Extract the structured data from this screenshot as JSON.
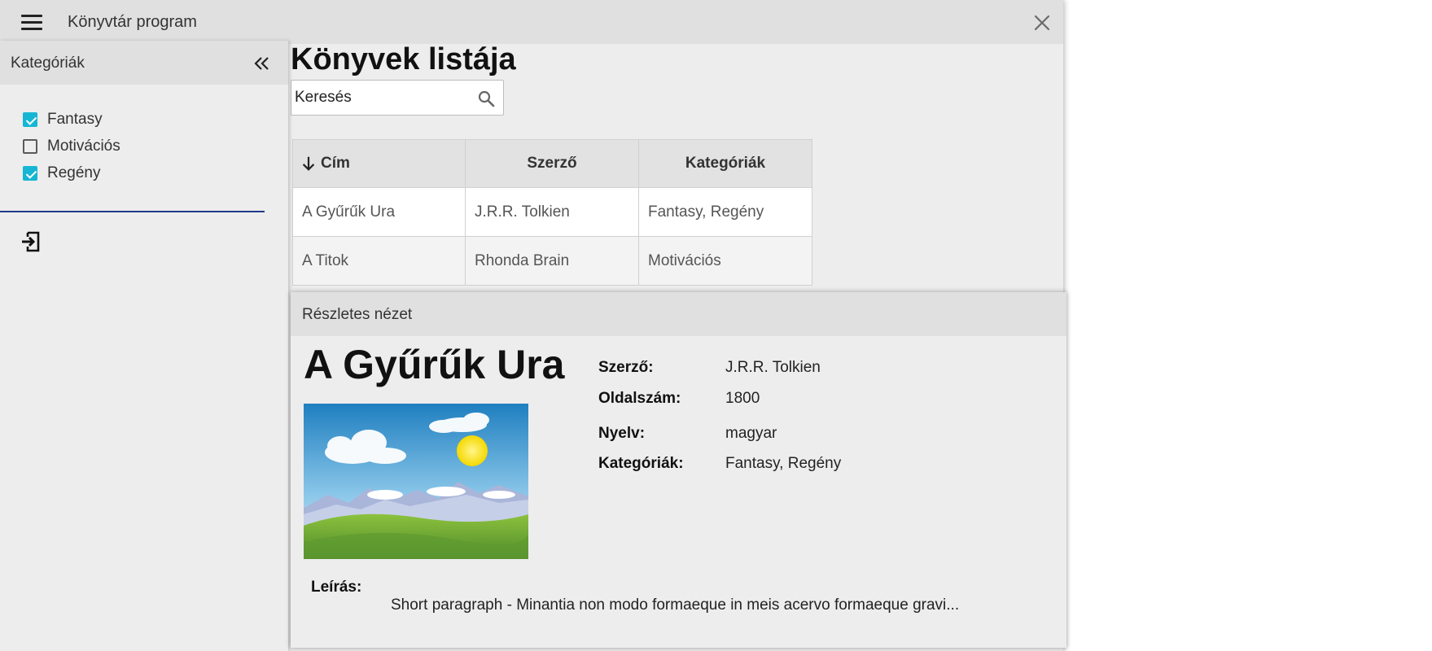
{
  "app": {
    "title": "Könyvtár program"
  },
  "sidebar": {
    "title": "Kategóriák",
    "categories": [
      {
        "label": "Fantasy",
        "checked": true
      },
      {
        "label": "Motivációs",
        "checked": false
      },
      {
        "label": "Regény",
        "checked": true
      }
    ]
  },
  "main": {
    "title": "Könyvek listája",
    "search": {
      "value": "Keresés"
    },
    "table": {
      "sort_column": "Cím",
      "sort_direction": "descending",
      "headers": [
        "Cím",
        "Szerző",
        "Kategóriák"
      ],
      "rows": [
        [
          "A Gyűrűk Ura",
          "J.R.R. Tolkien",
          "Fantasy, Regény"
        ],
        [
          "A Titok",
          "Rhonda Brain",
          "Motivációs"
        ]
      ]
    }
  },
  "detail": {
    "header": "Részletes nézet",
    "title": "A Gyűrűk Ura",
    "props": [
      {
        "label": "Szerző:",
        "value": "J.R.R. Tolkien"
      },
      {
        "label": "Oldalszám:",
        "value": "1800"
      },
      {
        "label": "Nyelv:",
        "value": "magyar"
      },
      {
        "label": "Kategóriák:",
        "value": "Fantasy, Regény"
      }
    ],
    "description_label": "Leírás:",
    "description": "Short paragraph - Minantia non modo formaeque in meis acervo formaeque gravi..."
  },
  "colors": {
    "accent": "#15b6d3",
    "divider": "#1f3a8a"
  }
}
